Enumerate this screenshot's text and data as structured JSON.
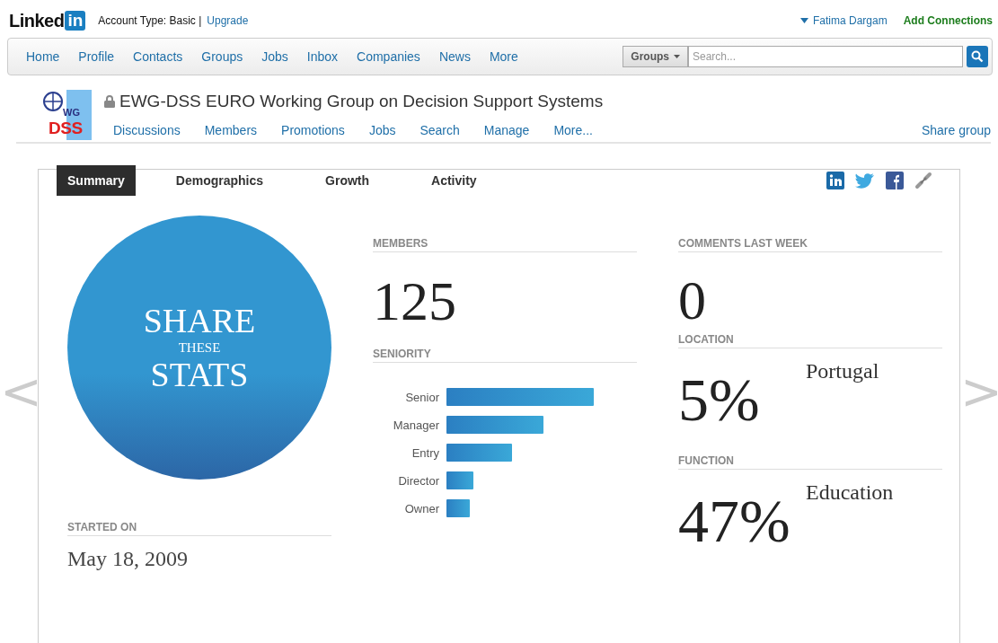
{
  "header": {
    "logo_word": "Linked",
    "logo_badge": "in",
    "account_label": "Account Type: Basic |",
    "upgrade_link": "Upgrade",
    "user_menu": "Fatima Dargam",
    "add_connections": "Add Connections"
  },
  "nav": {
    "items": [
      "Home",
      "Profile",
      "Contacts",
      "Groups",
      "Jobs",
      "Inbox",
      "Companies",
      "News",
      "More"
    ],
    "search_scope": "Groups",
    "search": {
      "placeholder": "Search..."
    }
  },
  "group": {
    "logo_top": "WG",
    "logo_bottom": "DSS",
    "title": "EWG-DSS EURO Working Group on Decision Support Systems",
    "locked": true,
    "menu": [
      "Discussions",
      "Members",
      "Promotions",
      "Jobs",
      "Search",
      "Manage",
      "More..."
    ],
    "share_link": "Share group"
  },
  "tabs": [
    {
      "label": "Summary",
      "selected": true
    },
    {
      "label": "Demographics",
      "selected": false
    },
    {
      "label": "Growth",
      "selected": false
    },
    {
      "label": "Activity",
      "selected": false
    }
  ],
  "share_circle": {
    "line_1": "SHARE",
    "line_2": "THESE",
    "line_3": "STATS"
  },
  "started": {
    "label": "STARTED ON",
    "value": "May 18, 2009"
  },
  "members": {
    "label": "MEMBERS",
    "value": "125"
  },
  "seniority": {
    "label": "SENIORITY",
    "rows": [
      {
        "name": "Senior"
      },
      {
        "name": "Manager"
      },
      {
        "name": "Entry"
      },
      {
        "name": "Director"
      },
      {
        "name": "Owner"
      }
    ]
  },
  "comments": {
    "label": "COMMENTS LAST WEEK",
    "value": "0"
  },
  "location": {
    "label": "LOCATION",
    "percent": "5%",
    "name": "Portugal"
  },
  "function": {
    "label": "FUNCTION",
    "percent": "47%",
    "name": "Education"
  },
  "pager": {
    "prev": "<",
    "next": ">"
  }
}
